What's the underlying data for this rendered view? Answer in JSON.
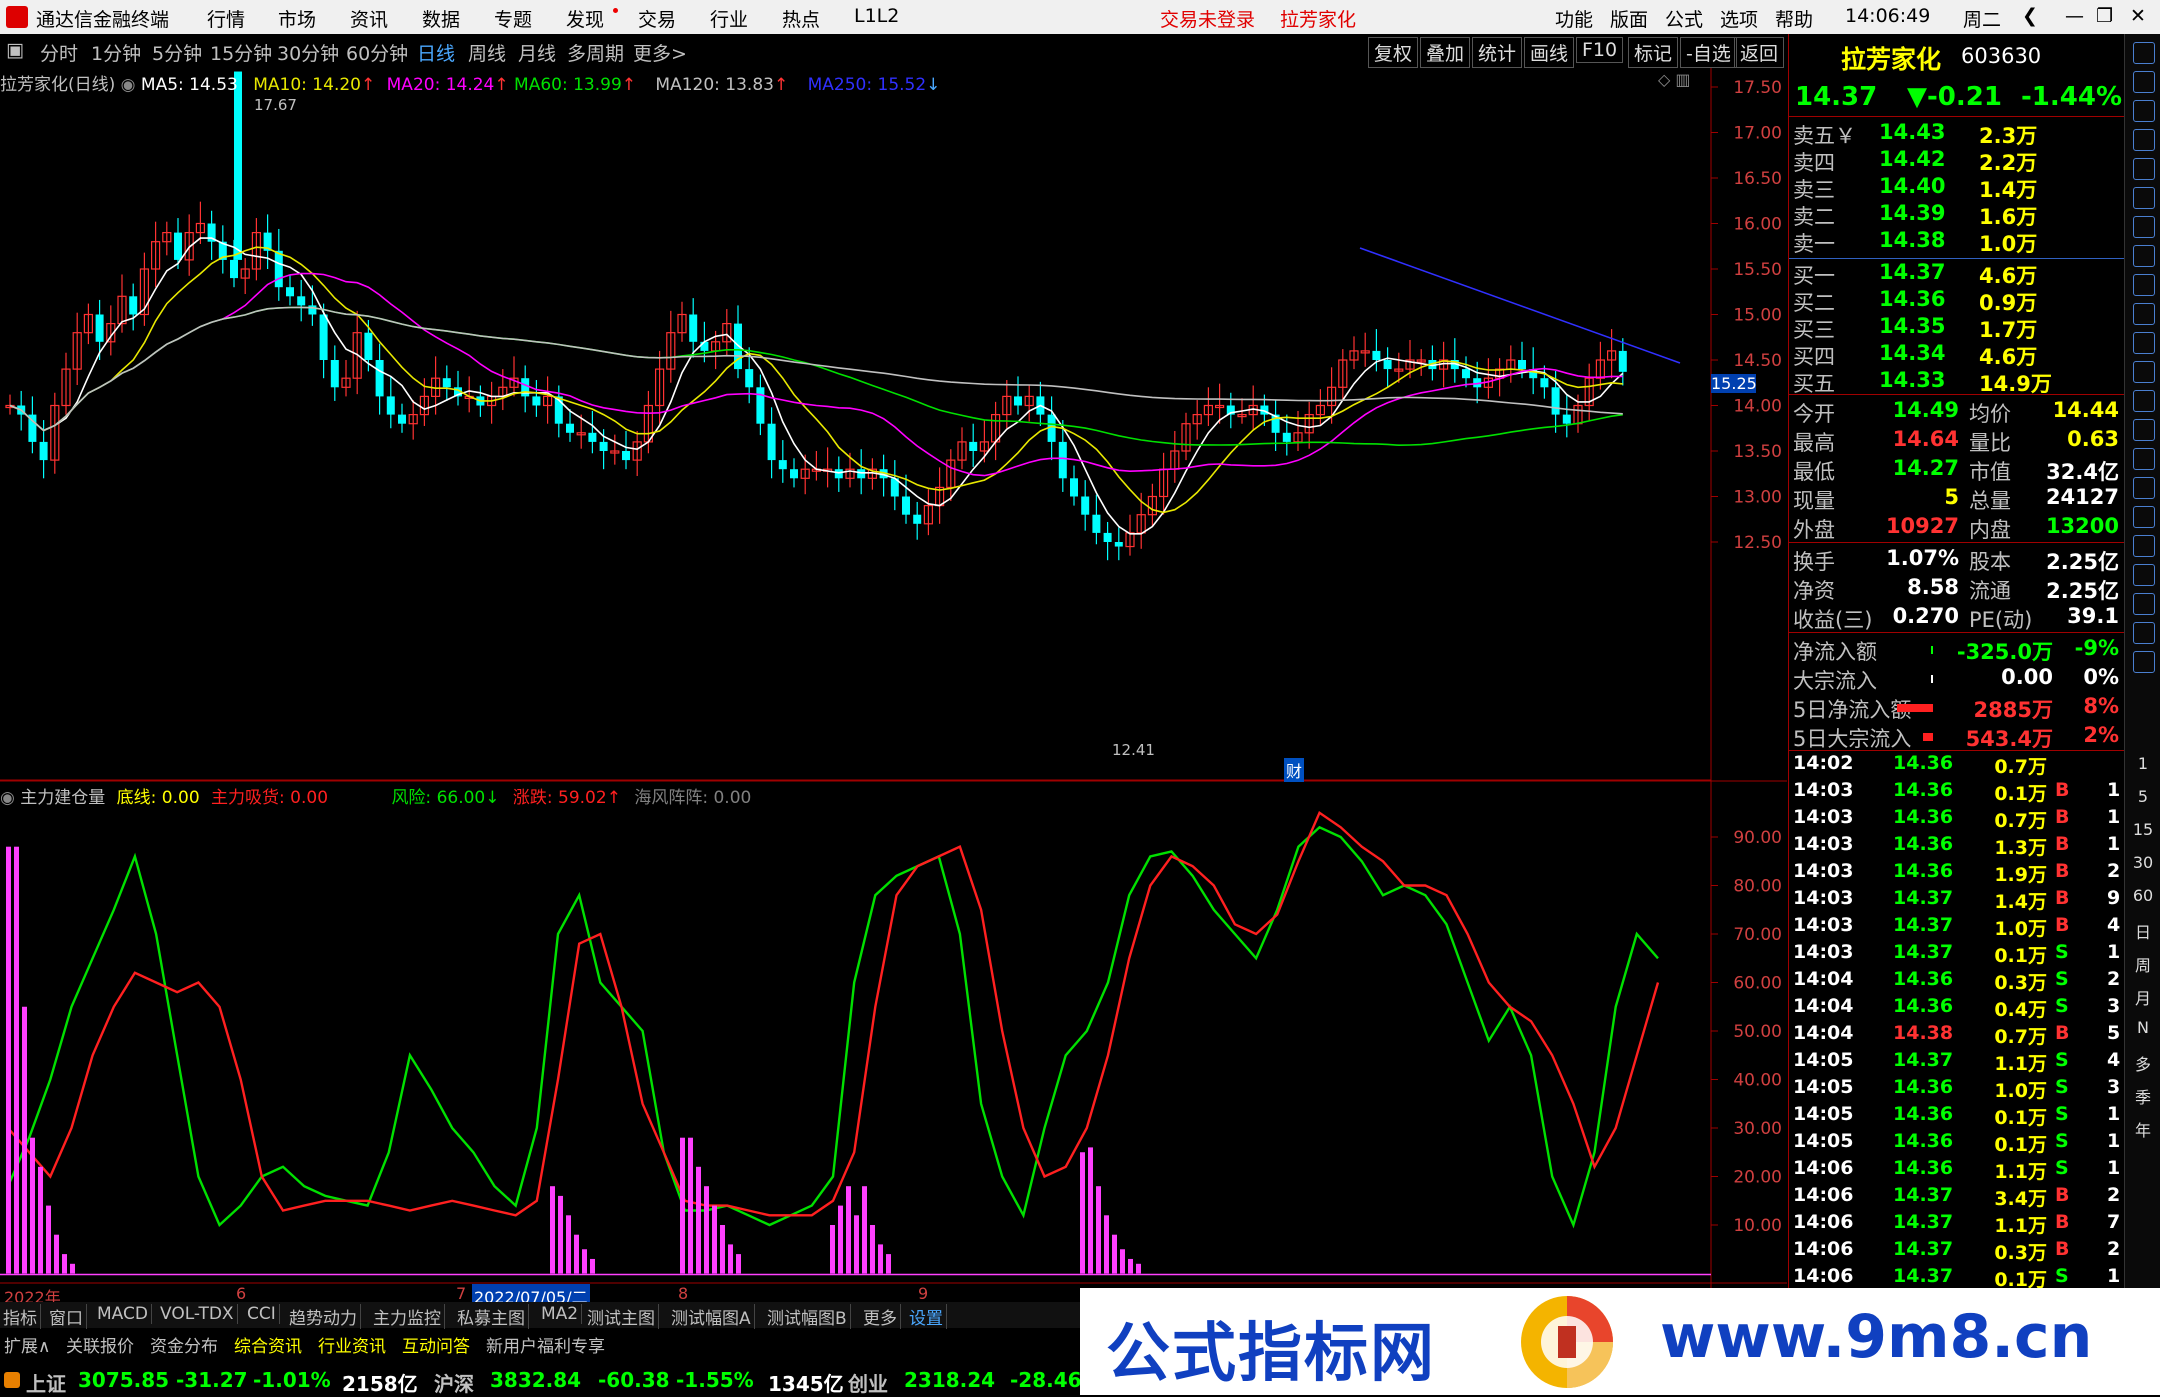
{
  "menubar": {
    "title": "通达信金融终端",
    "items": [
      "行情",
      "市场",
      "资讯",
      "数据",
      "专题",
      "发现",
      "交易",
      "行业",
      "热点",
      "L1L2"
    ],
    "center_login": "交易未登录",
    "center_stock": "拉芳家化",
    "right_items": [
      "功能",
      "版面",
      "公式",
      "选项",
      "帮助"
    ],
    "time": "14:06:49",
    "weekday": "周二"
  },
  "toolbar": {
    "periods": [
      "分时",
      "1分钟",
      "5分钟",
      "15分钟",
      "30分钟",
      "60分钟",
      "日线",
      "周线",
      "月线",
      "多周期",
      "更多>"
    ],
    "active": "日线",
    "right_buttons": [
      "复权",
      "叠加",
      "统计",
      "画线",
      "F10",
      "标记",
      "-自选",
      "返回"
    ]
  },
  "main_chart": {
    "title": "拉芳家化(日线)",
    "ma": [
      {
        "label": "MA5: 14.53",
        "color": "#ffffff"
      },
      {
        "label": "MA10: 14.20",
        "color": "#e8e800"
      },
      {
        "label": "MA20: 14.24",
        "color": "#ff00ff"
      },
      {
        "label": "MA60: 13.99",
        "color": "#00e000"
      },
      {
        "label": "MA120: 13.83",
        "color": "#c0c0c0"
      },
      {
        "label": "MA250: 15.52",
        "color": "#3030ff"
      }
    ],
    "price_labels": [
      "17.50",
      "17.00",
      "16.50",
      "16.00",
      "15.50",
      "15.00",
      "14.50",
      "14.00",
      "13.50",
      "13.00",
      "12.50"
    ],
    "current_marker": "15.25",
    "high_label": "17.67",
    "low_label": "12.41",
    "event_marker": "财"
  },
  "indicator": {
    "name": "主力建仓量",
    "items": [
      {
        "label": "底线: 0.00",
        "color": "#ffff00"
      },
      {
        "label": "主力吸货: 0.00",
        "color": "#ff2020"
      },
      {
        "label": "风险: 66.00↓",
        "color": "#00e000"
      },
      {
        "label": "涨跌: 59.02↑",
        "color": "#ff2020"
      },
      {
        "label": "海风阵阵: 0.00",
        "color": "#808080"
      }
    ],
    "y_labels": [
      "90.00",
      "80.00",
      "70.00",
      "60.00",
      "50.00",
      "40.00",
      "30.00",
      "20.00",
      "10.00"
    ]
  },
  "date_axis": {
    "labels": [
      "2022年",
      "6",
      "7",
      "8",
      "9"
    ],
    "highlight": "2022/07/05/二"
  },
  "subtabs": [
    "指标",
    "窗口",
    "MACD",
    "VOL-TDX",
    "CCI",
    "趋势动力",
    "主力监控",
    "私募主图",
    "MA2",
    "测试主图",
    "测试幅图A",
    "测试幅图B",
    "更多",
    "设置"
  ],
  "bottom_tabs": [
    "扩展∧",
    "关联报价",
    "资金分布",
    "综合资讯",
    "行业资讯",
    "互动问答",
    "新用户福利专享"
  ],
  "quote": {
    "name": "拉芳家化",
    "code": "603630",
    "price": "14.37",
    "change": "▼-0.21",
    "pct": "-1.44%",
    "asks": [
      [
        "卖五￥",
        "14.43",
        "2.3万"
      ],
      [
        "卖四",
        "14.42",
        "2.2万"
      ],
      [
        "卖三",
        "14.40",
        "1.4万"
      ],
      [
        "卖二",
        "14.39",
        "1.6万"
      ],
      [
        "卖一",
        "14.38",
        "1.0万"
      ]
    ],
    "bids": [
      [
        "买一",
        "14.37",
        "4.6万"
      ],
      [
        "买二",
        "14.36",
        "0.9万"
      ],
      [
        "买三",
        "14.35",
        "1.7万"
      ],
      [
        "买四",
        "14.34",
        "4.6万"
      ],
      [
        "买五",
        "14.33",
        "14.9万"
      ]
    ],
    "stats1": [
      [
        "今开",
        "14.49",
        "均价",
        "14.44"
      ],
      [
        "最高",
        "14.64",
        "量比",
        "0.63"
      ],
      [
        "最低",
        "14.27",
        "市值",
        "32.4亿"
      ],
      [
        "现量",
        "5",
        "总量",
        "24127"
      ],
      [
        "外盘",
        "10927",
        "内盘",
        "13200"
      ]
    ],
    "stats2": [
      [
        "换手",
        "1.07%",
        "股本",
        "2.25亿"
      ],
      [
        "净资",
        "8.58",
        "流通",
        "2.25亿"
      ],
      [
        "收益(三)",
        "0.270",
        "PE(动)",
        "39.1"
      ]
    ],
    "flows": [
      [
        "净流入额",
        "-325.0万",
        "-9%"
      ],
      [
        "大宗流入",
        "0.00",
        "0%"
      ],
      [
        "5日净流入额",
        "2885万",
        "8%"
      ],
      [
        "5日大宗流入",
        "543.4万",
        "2%"
      ]
    ],
    "ticks": [
      [
        "14:02",
        "14.36",
        "0.7万",
        "",
        ""
      ],
      [
        "14:03",
        "14.36",
        "0.1万",
        "B",
        "1"
      ],
      [
        "14:03",
        "14.36",
        "0.7万",
        "B",
        "1"
      ],
      [
        "14:03",
        "14.36",
        "1.3万",
        "B",
        "1"
      ],
      [
        "14:03",
        "14.36",
        "1.9万",
        "B",
        "2"
      ],
      [
        "14:03",
        "14.37",
        "1.4万",
        "B",
        "9"
      ],
      [
        "14:03",
        "14.37",
        "1.0万",
        "B",
        "4"
      ],
      [
        "14:03",
        "14.37",
        "0.1万",
        "S",
        "1"
      ],
      [
        "14:04",
        "14.36",
        "0.3万",
        "S",
        "2"
      ],
      [
        "14:04",
        "14.36",
        "0.4万",
        "S",
        "3"
      ],
      [
        "14:04",
        "14.38",
        "0.7万",
        "B",
        "5"
      ],
      [
        "14:05",
        "14.37",
        "1.1万",
        "S",
        "4"
      ],
      [
        "14:05",
        "14.36",
        "1.0万",
        "S",
        "3"
      ],
      [
        "14:05",
        "14.36",
        "0.1万",
        "S",
        "1"
      ],
      [
        "14:05",
        "14.36",
        "0.1万",
        "S",
        "1"
      ],
      [
        "14:06",
        "14.36",
        "1.1万",
        "S",
        "1"
      ],
      [
        "14:06",
        "14.37",
        "3.4万",
        "B",
        "2"
      ],
      [
        "14:06",
        "14.37",
        "1.1万",
        "B",
        "7"
      ],
      [
        "14:06",
        "14.37",
        "0.3万",
        "B",
        "2"
      ],
      [
        "14:06",
        "14.37",
        "0.1万",
        "S",
        "1"
      ]
    ]
  },
  "right_toolbar": [
    "1",
    "5",
    "15",
    "30",
    "60",
    "日",
    "周",
    "月",
    "N",
    "多",
    "季",
    "年"
  ],
  "status": [
    {
      "name": "上证",
      "val": "3075.85",
      "chg": "-31.27",
      "pct": "-1.01%",
      "amt": "2158亿"
    },
    {
      "name": "沪深",
      "val": "3832.84",
      "chg": "-60.38",
      "pct": "-1.55%",
      "amt": "1345亿"
    },
    {
      "name": "创业",
      "val": "2318.24",
      "chg": "-28.46",
      "pct": "",
      "amt": ""
    }
  ],
  "banner": {
    "left": "公式指标网",
    "right": "www.9m8.cn"
  },
  "colors": {
    "up": "#ff3232",
    "down": "#00ffff",
    "ma5": "#ffffff",
    "ma10": "#e8e800",
    "ma20": "#ff00ff",
    "ma60": "#00e000",
    "ma120": "#c0c0c0",
    "ma250": "#3030ff",
    "green": "#00e000",
    "red": "#ff2020",
    "yellow": "#ffff00"
  }
}
